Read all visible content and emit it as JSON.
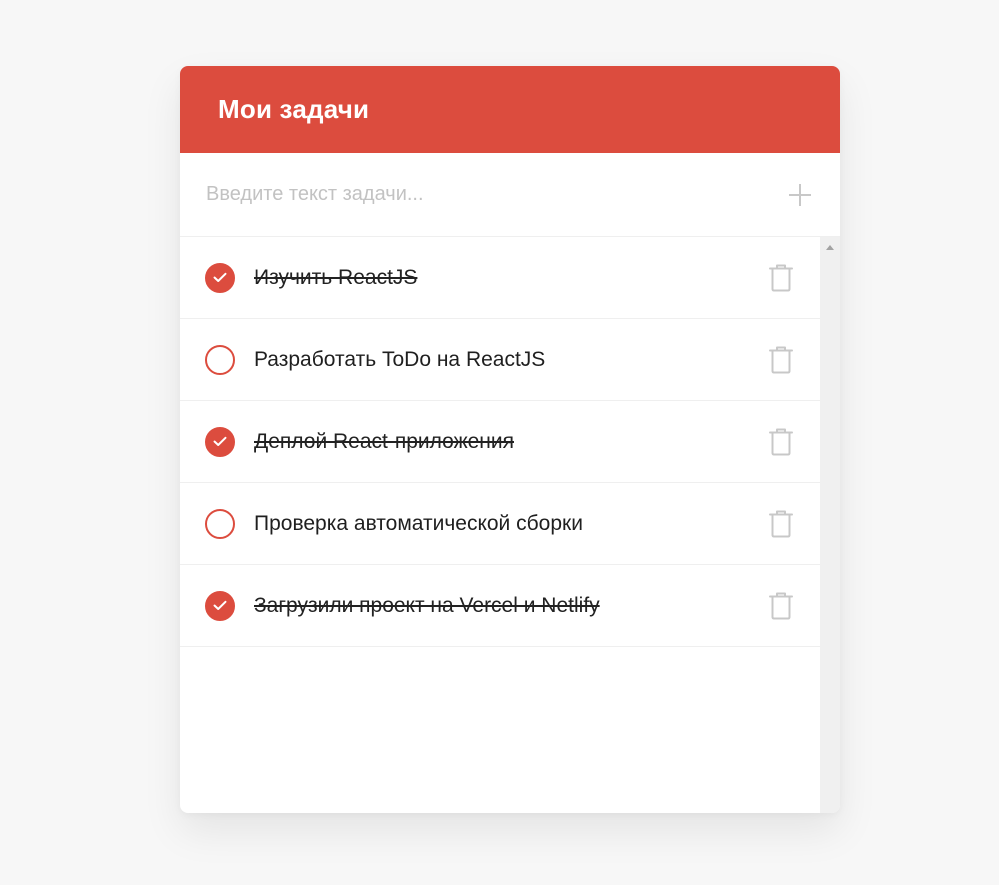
{
  "header": {
    "title": "Мои задачи"
  },
  "input": {
    "placeholder": "Введите текст задачи...",
    "value": ""
  },
  "colors": {
    "accent": "#dc4c3e",
    "icon_muted": "#c8c8c8"
  },
  "tasks": [
    {
      "text": "Изучить ReactJS",
      "done": true
    },
    {
      "text": "Разработать ToDo на ReactJS",
      "done": false
    },
    {
      "text": "Деплой React-приложения",
      "done": true
    },
    {
      "text": "Проверка автоматической сборки",
      "done": false
    },
    {
      "text": "Загрузили проект на Vercel и Netlify",
      "done": true
    }
  ]
}
